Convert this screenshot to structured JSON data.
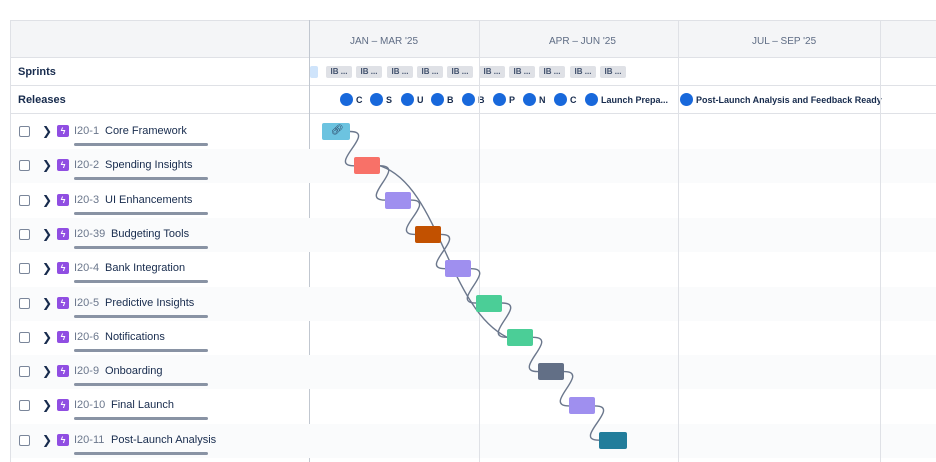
{
  "timeline": {
    "quarters": [
      {
        "label": "JAN – MAR '25"
      },
      {
        "label": "APR – JUN '25"
      },
      {
        "label": "JUL – SEP '25"
      }
    ]
  },
  "rows": {
    "sprints_label": "Sprints",
    "releases_label": "Releases"
  },
  "sprints": [
    "",
    "IB ...",
    "IB ...",
    "IB ...",
    "IB ...",
    "IB ...",
    "IB ...",
    "IB ...",
    "IB ...",
    "IB ...",
    "IB ..."
  ],
  "releases": [
    {
      "label": "C"
    },
    {
      "label": "S"
    },
    {
      "label": "U"
    },
    {
      "label": "B"
    },
    {
      "label": "B"
    },
    {
      "label": "P"
    },
    {
      "label": "N"
    },
    {
      "label": "C"
    },
    {
      "label": "Launch Prepa..."
    },
    {
      "label": "Post-Launch Analysis and Feedback Ready"
    }
  ],
  "issues": [
    {
      "key": "I20-1",
      "title": "Core Framework",
      "color": "#6cc3e0",
      "link_icon": "link-icon"
    },
    {
      "key": "I20-2",
      "title": "Spending Insights",
      "color": "#f87168"
    },
    {
      "key": "I20-3",
      "title": "UI Enhancements",
      "color": "#9f8fef"
    },
    {
      "key": "I20-39",
      "title": "Budgeting Tools",
      "color": "#c25100"
    },
    {
      "key": "I20-4",
      "title": "Bank Integration",
      "color": "#9f8fef"
    },
    {
      "key": "I20-5",
      "title": "Predictive Insights",
      "color": "#4bce97"
    },
    {
      "key": "I20-6",
      "title": "Notifications",
      "color": "#4bce97"
    },
    {
      "key": "I20-9",
      "title": "Onboarding",
      "color": "#626f86"
    },
    {
      "key": "I20-10",
      "title": "Final Launch",
      "color": "#9f8fef"
    },
    {
      "key": "I20-11",
      "title": "Post-Launch Analysis",
      "color": "#227d9b"
    }
  ],
  "icons": {
    "expand": "chevron-right-icon",
    "epic": "lightning-icon",
    "release": "release-dot-icon"
  }
}
